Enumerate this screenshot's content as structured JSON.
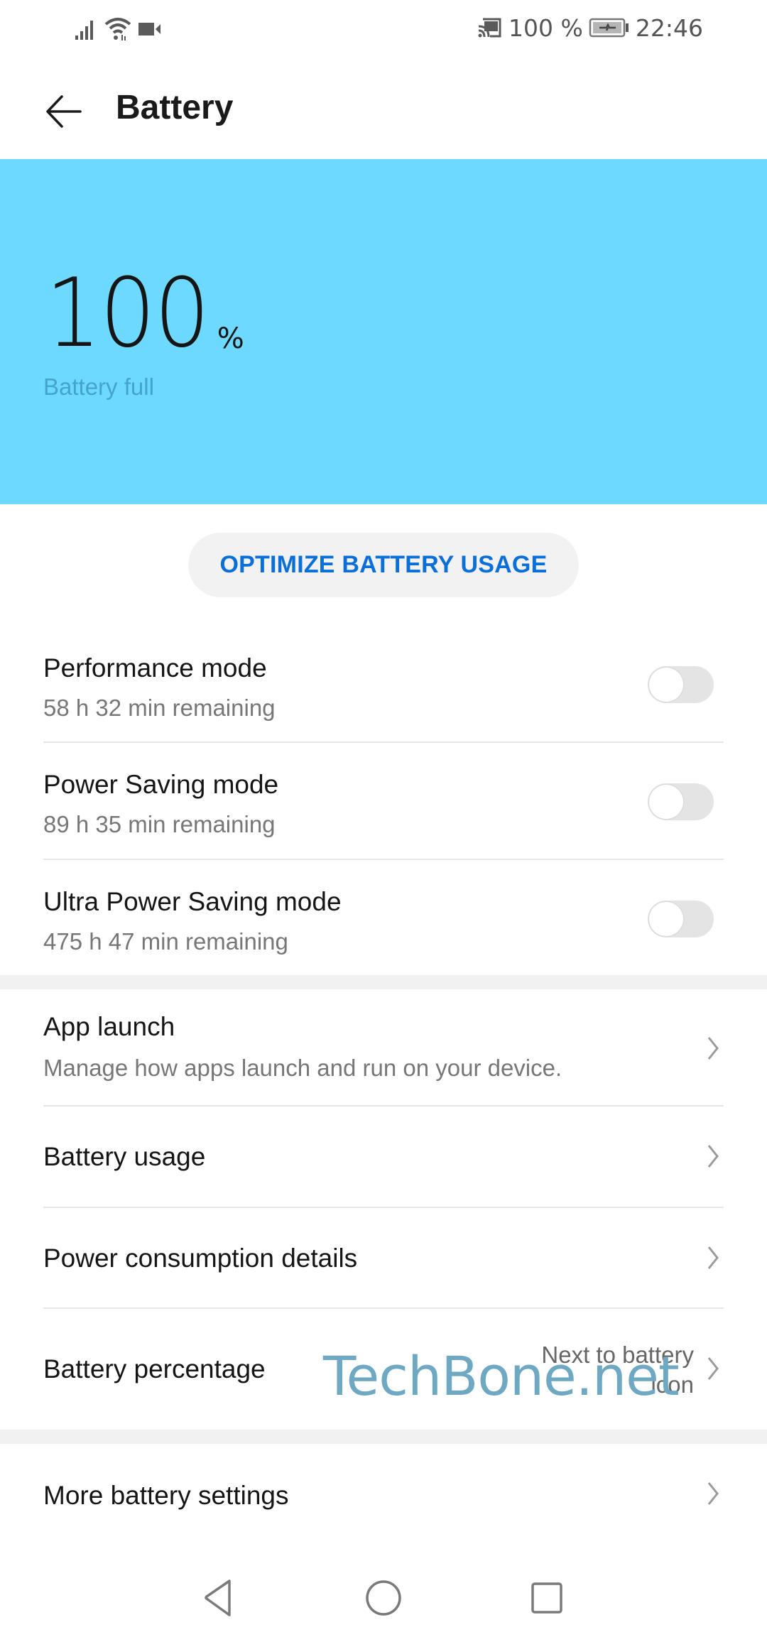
{
  "status_bar": {
    "left_icons": [
      "signal-icon",
      "wifi-icon",
      "video-camera-icon"
    ],
    "right_icons": [
      "screencast-icon",
      "battery-charging-icon"
    ],
    "battery_text": "100 %",
    "time": "22:46"
  },
  "header": {
    "back_icon": "arrow-left-icon",
    "title": "Battery"
  },
  "hero": {
    "background_color": "#6dd9ff",
    "level_number": "100",
    "level_unit": "%",
    "status": "Battery full"
  },
  "optimize_button": {
    "label": "OPTIMIZE BATTERY USAGE",
    "color": "#0a6fd8"
  },
  "modes": [
    {
      "title": "Performance mode",
      "subtitle": "58 h 32 min remaining",
      "enabled": false
    },
    {
      "title": "Power Saving mode",
      "subtitle": "89 h 35 min remaining",
      "enabled": false
    },
    {
      "title": "Ultra Power Saving mode",
      "subtitle": "475 h 47 min remaining",
      "enabled": false
    }
  ],
  "settings": [
    {
      "title": "App launch",
      "subtitle": "Manage how apps launch and run on your device."
    },
    {
      "title": "Battery usage"
    },
    {
      "title": "Power consumption details"
    },
    {
      "title": "Battery percentage",
      "value_line1": "Next to battery",
      "value_line2": "icon"
    }
  ],
  "more_settings": {
    "title": "More battery settings"
  },
  "watermark": "TechBone.net",
  "nav_bar": {
    "buttons": [
      "back-triangle-icon",
      "home-circle-icon",
      "recents-square-icon"
    ]
  }
}
